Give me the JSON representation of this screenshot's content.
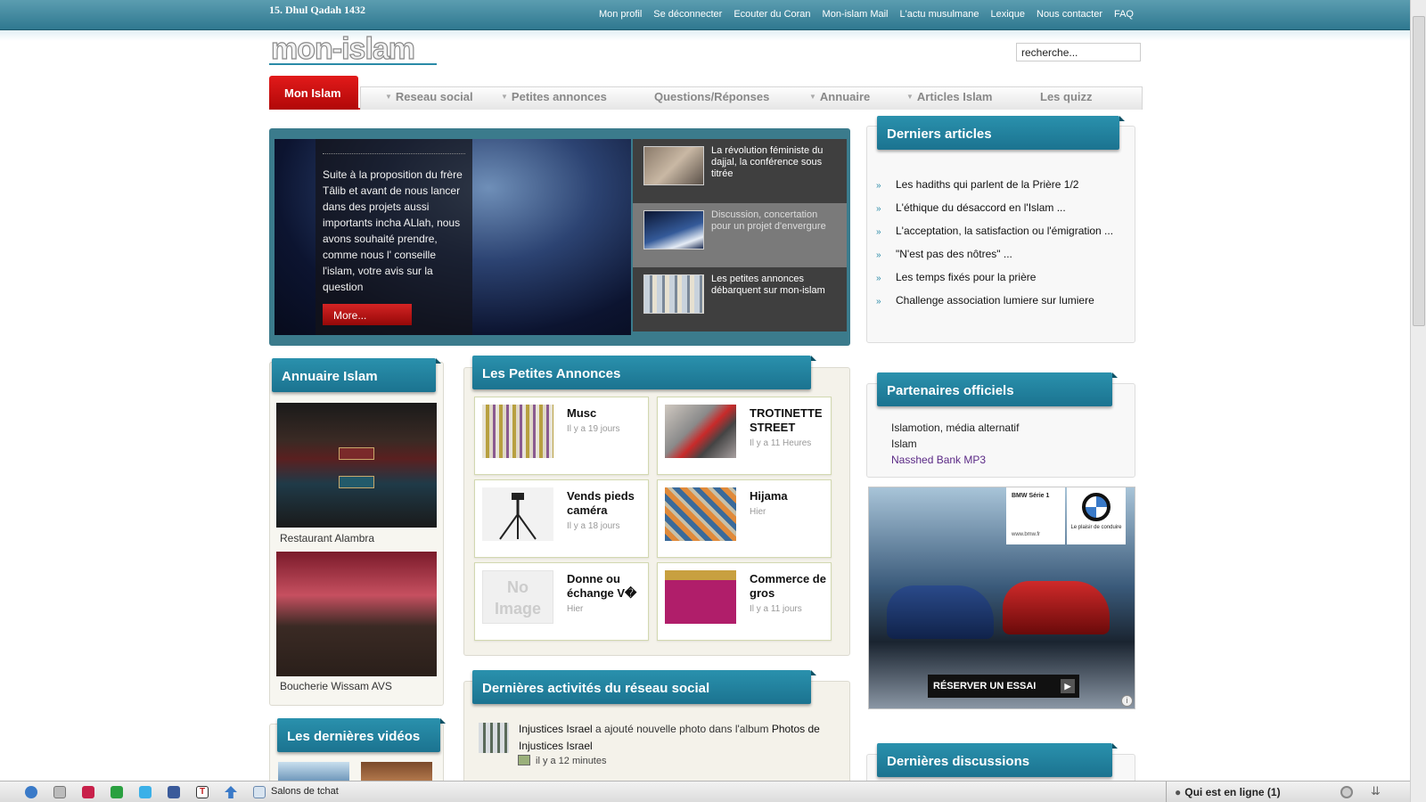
{
  "header": {
    "hijri_date": "15. Dhul Qadah 1432",
    "top_links": [
      "Mon profil",
      "Se déconnecter",
      "Ecouter du Coran",
      "Mon-islam Mail",
      "L'actu musulmane",
      "Lexique",
      "Nous contacter",
      "FAQ"
    ],
    "logo_text": "mon-islam",
    "search_value": "recherche..."
  },
  "nav": {
    "active": "Mon Islam",
    "items": [
      "Reseau social",
      "Petites annonces",
      "Questions/Réponses",
      "Annuaire",
      "Articles Islam",
      "Les quizz"
    ]
  },
  "slider": {
    "text": "Suite à la proposition du frère Tâlib et avant de nous lancer dans des projets aussi importants incha ALlah, nous avons souhaité prendre, comme nous l' conseille l'islam, votre avis sur la question",
    "more": "More...",
    "thumbs": [
      "La révolution féministe du dajjal, la conférence sous titrée",
      "Discussion, concertation pour un projet d'envergure",
      "Les petites annonces débarquent sur mon-islam"
    ]
  },
  "annuaire": {
    "title": "Annuaire Islam",
    "entries": [
      "Restaurant Alambra",
      "Boucherie Wissam AVS"
    ]
  },
  "videos": {
    "title": "Les dernières vidéos"
  },
  "annonces": {
    "title": "Les Petites Annonces",
    "items": [
      {
        "title": "Musc",
        "time": "Il y a 19 jours"
      },
      {
        "title": "TROTINETTE STREET",
        "time": "Il y a 11 Heures"
      },
      {
        "title": "Vends pieds caméra",
        "time": "Il y a 18 jours"
      },
      {
        "title": "Hijama",
        "time": "Hier"
      },
      {
        "title": "Donne ou échange V�",
        "time": "Hier"
      },
      {
        "title": "Commerce de gros",
        "time": "Il y a 11 jours"
      }
    ],
    "no_image_text": "No Image"
  },
  "activity": {
    "title": "Dernières activités du réseau social",
    "user": "Injustices Israel",
    "action": " a ajouté nouvelle photo dans l'album ",
    "album": "Photos de Injustices Israel",
    "time": "il y a 12 minutes"
  },
  "articles": {
    "title": "Derniers articles",
    "items": [
      "Les hadiths qui parlent de la Prière 1/2",
      "L'éthique du désaccord en l'Islam ...",
      "L'acceptation, la satisfaction ou l'émigration ...",
      "\"N'est pas des nôtres\" ...",
      "Les temps fixés pour la prière",
      "Challenge association lumiere sur lumiere"
    ]
  },
  "partners": {
    "title": "Partenaires officiels",
    "items": [
      "Islamotion, média alternatif",
      "Islam",
      "Nasshed Bank MP3"
    ]
  },
  "ad": {
    "label": "BMW Série 1",
    "url": "www.bmw.fr",
    "slogan": "Le plaisir de conduire",
    "cta": "RÉSERVER UN ESSAI"
  },
  "discussions": {
    "title": "Dernières discussions"
  },
  "bottom_bar": {
    "chat": "Salons de tchat",
    "online": "Qui est en ligne (1)"
  },
  "colors": {
    "topbar": "#2f7890",
    "accent_red": "#d81010",
    "tab_blue": "#1b7390",
    "link_purple": "#5b2a86"
  }
}
